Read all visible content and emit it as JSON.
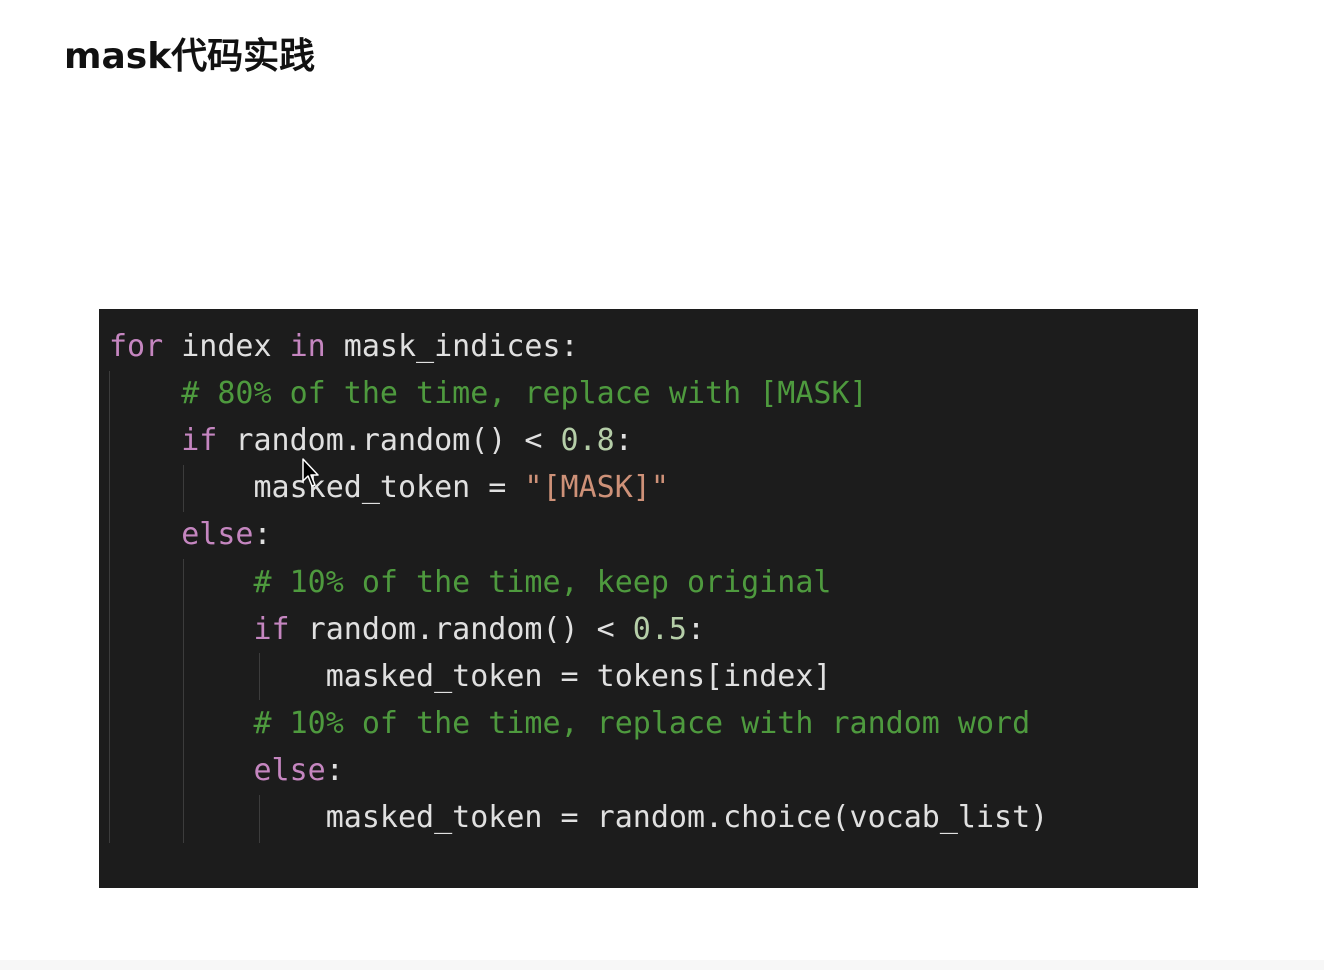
{
  "page": {
    "title": "mask代码实践"
  },
  "code": {
    "lines": [
      [
        {
          "t": "for",
          "c": "kw"
        },
        {
          "t": " index ",
          "c": "op"
        },
        {
          "t": "in",
          "c": "kw"
        },
        {
          "t": " mask_indices:",
          "c": "op"
        }
      ],
      [
        {
          "t": "    # 80% of the time, replace with [MASK]",
          "c": "cm"
        }
      ],
      [
        {
          "t": "    ",
          "c": "op"
        },
        {
          "t": "if",
          "c": "kw"
        },
        {
          "t": " random.random() < ",
          "c": "op"
        },
        {
          "t": "0.8",
          "c": "num"
        },
        {
          "t": ":",
          "c": "op"
        }
      ],
      [
        {
          "t": "        masked_token = ",
          "c": "op"
        },
        {
          "t": "\"[MASK]\"",
          "c": "str"
        }
      ],
      [
        {
          "t": "    ",
          "c": "op"
        },
        {
          "t": "else",
          "c": "kw"
        },
        {
          "t": ":",
          "c": "op"
        }
      ],
      [
        {
          "t": "        # 10% of the time, keep original",
          "c": "cm"
        }
      ],
      [
        {
          "t": "        ",
          "c": "op"
        },
        {
          "t": "if",
          "c": "kw"
        },
        {
          "t": " random.random() < ",
          "c": "op"
        },
        {
          "t": "0.5",
          "c": "num"
        },
        {
          "t": ":",
          "c": "op"
        }
      ],
      [
        {
          "t": "            masked_token = tokens[index]",
          "c": "op"
        }
      ],
      [
        {
          "t": "        # 10% of the time, replace with random word",
          "c": "cm"
        }
      ],
      [
        {
          "t": "        ",
          "c": "op"
        },
        {
          "t": "else",
          "c": "kw"
        },
        {
          "t": ":",
          "c": "op"
        }
      ],
      [
        {
          "t": "            masked_token = random.choice(vocab_list)",
          "c": "op"
        }
      ]
    ]
  },
  "colors": {
    "background": "#ffffff",
    "code_background": "#1c1c1c",
    "keyword": "#c586c0",
    "comment": "#4e9a3e",
    "number": "#b5cea8",
    "string": "#ce9178",
    "text": "#e0e0e0"
  },
  "icons": {
    "cursor": "mouse-pointer-icon"
  }
}
